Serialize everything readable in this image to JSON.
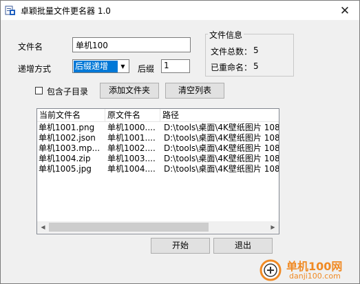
{
  "window": {
    "title": "卓颖批量文件更名器 1.0",
    "close_glyph": "✕"
  },
  "form": {
    "filename_label": "文件名",
    "filename_value": "单机100",
    "increment_label": "递增方式",
    "increment_selected": "后缀递增",
    "suffix_label": "后缀",
    "suffix_value": "1"
  },
  "file_info": {
    "group_title": "文件信息",
    "total_label": "文件总数：",
    "total_value": "5",
    "renamed_label": "已重命名：",
    "renamed_value": "5"
  },
  "options": {
    "include_subdirs_label": "包含子目录",
    "include_subdirs_checked": false,
    "add_folder_button": "添加文件夹",
    "clear_list_button": "清空列表"
  },
  "file_list": {
    "columns": [
      "当前文件名",
      "原文件名",
      "路径"
    ],
    "rows": [
      [
        "单机1001.png",
        "单机1000....",
        "D:\\tools\\桌面\\4K壁纸图片 108("
      ],
      [
        "单机1002.json",
        "单机1001....",
        "D:\\tools\\桌面\\4K壁纸图片 108("
      ],
      [
        "单机1003.mp...",
        "单机1002....",
        "D:\\tools\\桌面\\4K壁纸图片 108("
      ],
      [
        "单机1004.zip",
        "单机1003....",
        "D:\\tools\\桌面\\4K壁纸图片 108("
      ],
      [
        "单机1005.jpg",
        "单机1004....",
        "D:\\tools\\桌面\\4K壁纸图片 108("
      ]
    ]
  },
  "actions": {
    "start_button": "开始",
    "exit_button": "退出"
  },
  "watermark": {
    "site_cn": "单机100网",
    "site_url": "danji100.com"
  },
  "colors": {
    "selected_bg": "#0078d7",
    "watermark_orange": "#f08a24"
  }
}
